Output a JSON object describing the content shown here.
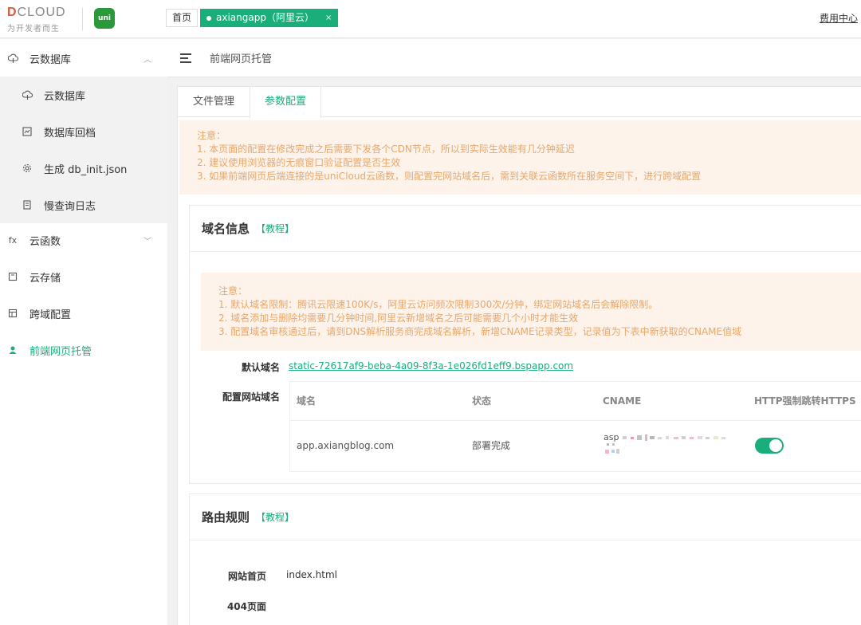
{
  "header": {
    "logo_brand": "DCLOUD",
    "logo_tagline": "为开发者而生",
    "uni_logo": "uni",
    "tabs": [
      {
        "label": "首页"
      },
      {
        "label": "axiangapp（阿里云）",
        "close": "×"
      }
    ],
    "fee_link": "费用中心"
  },
  "sidebar": {
    "items": [
      {
        "icon": "database-icon",
        "label": "云数据库",
        "expanded": true
      },
      {
        "icon": "database-icon",
        "label": "云数据库",
        "sub": true
      },
      {
        "icon": "backup-icon",
        "label": "数据库回档",
        "sub": true
      },
      {
        "icon": "gear-icon",
        "label": "生成 db_init.json",
        "sub": true
      },
      {
        "icon": "log-icon",
        "label": "慢查询日志",
        "sub": true
      },
      {
        "icon": "function-icon",
        "label": "云函数",
        "glyph": "fx",
        "expanded": false
      },
      {
        "icon": "storage-icon",
        "label": "云存储"
      },
      {
        "icon": "cross-domain-icon",
        "label": "跨域配置"
      },
      {
        "icon": "hosting-icon",
        "label": "前端网页托管",
        "active": true
      }
    ]
  },
  "breadcrumb": {
    "title": "前端网页托管"
  },
  "content_tabs": [
    {
      "label": "文件管理"
    },
    {
      "label": "参数配置",
      "active": true
    }
  ],
  "notice_top": {
    "title": "注意：",
    "lines": [
      "1. 本页面的配置在修改完成之后需要下发各个CDN节点，所以到实际生效能有几分钟延迟",
      "2. 建议使用浏览器的无痕窗口验证配置是否生效",
      "3. 如果前端网页后端连接的是uniCloud云函数，则配置完网站域名后，需到关联云函数所在服务空间下，进行跨域配置"
    ]
  },
  "domain_card": {
    "title": "域名信息",
    "tutorial": "【教程】",
    "notice": {
      "title": "注意：",
      "lines": [
        "1. 默认域名限制：腾讯云限速100K/s，阿里云访问频次限制300次/分钟，绑定网站域名后会解除限制。",
        "2. 域名添加与删除均需要几分钟时间,阿里云新增域名之后可能需要几个小时才能生效",
        "3. 配置域名审核通过后，请到DNS解析服务商完成域名解析，新增CNAME记录类型，记录值为下表中新获取的CNAME值域"
      ]
    },
    "default_domain_label": "默认域名",
    "default_domain": "static-72617af9-beba-4a09-8f3a-1e026fd1eff9.bspapp.com",
    "site_domain_label": "配置网站域名",
    "table": {
      "headers": [
        "域名",
        "状态",
        "CNAME",
        "HTTP强制跳转HTTPS"
      ],
      "rows": [
        {
          "domain": "app.axiangblog.com",
          "status": "部署完成",
          "cname_prefix": "asp",
          "https_redirect": true
        }
      ]
    }
  },
  "route_card": {
    "title": "路由规则",
    "tutorial": "【教程】",
    "home_label": "网站首页",
    "home_value": "index.html",
    "notfound_label": "404页面"
  },
  "colors": {
    "accent": "#1aae7a",
    "notice_bg": "#fdf3ea",
    "notice_text": "#e8a76b"
  }
}
